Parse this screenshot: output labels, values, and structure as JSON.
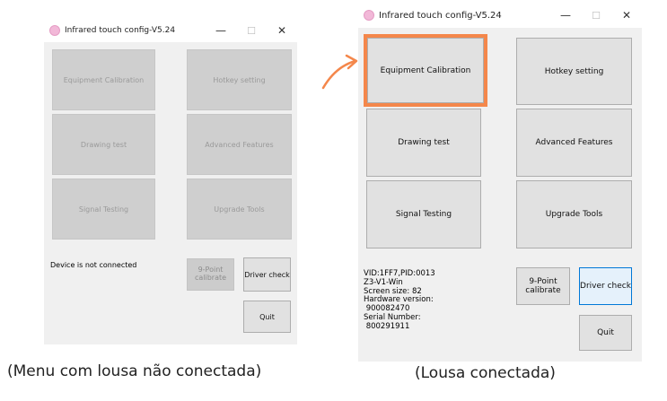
{
  "title": "Infrared touch config-V5.24",
  "title_controls": {
    "minimize": "—",
    "maximize": "☐",
    "close": "✕"
  },
  "left_window": {
    "buttons": {
      "equipment_calibration": "Equipment Calibration",
      "hotkey_setting": "Hotkey setting",
      "drawing_test": "Drawing test",
      "advanced_features": "Advanced Features",
      "signal_testing": "Signal Testing",
      "upgrade_tools": "Upgrade Tools",
      "nine_point": "9-Point\ncalibrate",
      "driver_check": "Driver check",
      "quit": "Quit"
    },
    "status": "Device is not connected"
  },
  "right_window": {
    "buttons": {
      "equipment_calibration": "Equipment Calibration",
      "hotkey_setting": "Hotkey setting",
      "drawing_test": "Drawing test",
      "advanced_features": "Advanced Features",
      "signal_testing": "Signal Testing",
      "upgrade_tools": "Upgrade Tools",
      "nine_point": "9-Point\ncalibrate",
      "driver_check": "Driver check",
      "quit": "Quit"
    },
    "status": "VID:1FF7,PID:0013\nZ3-V1-Win\nScreen size: 82\nHardware version:\n 900082470\nSerial Number:\n 800291911"
  },
  "captions": {
    "left": "(Menu com lousa não conectada)",
    "right": "(Lousa conectada)"
  },
  "colors": {
    "highlight": "#f4874b",
    "focus": "#0078d7"
  }
}
